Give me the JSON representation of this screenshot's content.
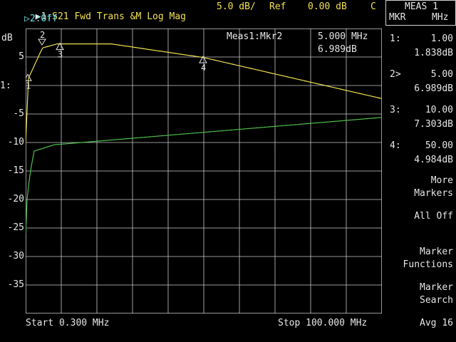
{
  "header": {
    "trace1_indicator": "▶1:",
    "trace1_label": "S21 Fwd Trans",
    "trace1_format": "&M Log Mag",
    "scale": "5.0 dB/",
    "ref_label": "Ref",
    "ref_value": "0.00 dB",
    "cal_flag": "C",
    "trace2_label": "▷2:Off"
  },
  "y_axis": {
    "unit_label": "dB",
    "ticks": [
      "5",
      "1:",
      "-5",
      "-10",
      "-15",
      "-20",
      "-25",
      "-30",
      "-35"
    ]
  },
  "footer": {
    "start": "Start 0.300 MHz",
    "stop": "Stop 100.000 MHz"
  },
  "marker_readout": {
    "title": "Meas1:Mkr2",
    "freq": "5.000 MHz",
    "value": "6.989dB"
  },
  "marker_labels": [
    "1",
    "2",
    "3",
    "4"
  ],
  "softkeys": {
    "title": "MEAS 1",
    "subtitle_left": "MKR",
    "subtitle_right": "MHz",
    "markers": [
      {
        "id": "1:",
        "freq": "1.00",
        "value": "1.838dB"
      },
      {
        "id": "2>",
        "freq": "5.00",
        "value": "6.989dB"
      },
      {
        "id": "3:",
        "freq": "10.00",
        "value": "7.303dB"
      },
      {
        "id": "4:",
        "freq": "50.00",
        "value": "4.984dB"
      }
    ],
    "more_markers_line1": "More",
    "more_markers_line2": "Markers",
    "all_off": "All Off",
    "marker_functions_line1": "Marker",
    "marker_functions_line2": "Functions",
    "marker_search_line1": "Marker",
    "marker_search_line2": "Search",
    "avg": "Avg 16"
  },
  "colors": {
    "trace1": "#f0e050",
    "trace2": "#50c050",
    "grid": "#c8c8c8",
    "background": "#000000"
  }
}
